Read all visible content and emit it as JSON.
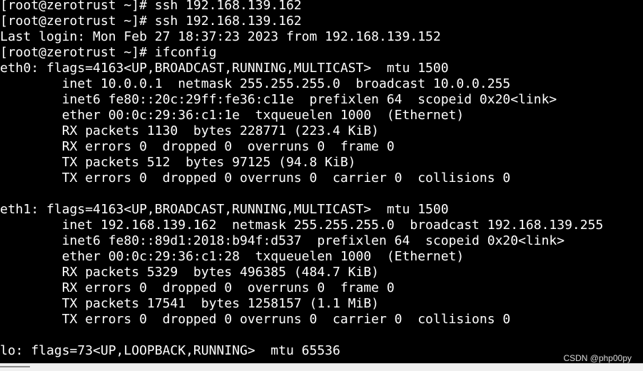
{
  "terminal": {
    "lines": [
      "[root@zerotrust ~]# ssh 192.168.139.162",
      "[root@zerotrust ~]# ssh 192.168.139.162",
      "Last login: Mon Feb 27 18:37:23 2023 from 192.168.139.152",
      "[root@zerotrust ~]# ifconfig",
      "eth0: flags=4163<UP,BROADCAST,RUNNING,MULTICAST>  mtu 1500",
      "        inet 10.0.0.1  netmask 255.255.255.0  broadcast 10.0.0.255",
      "        inet6 fe80::20c:29ff:fe36:c11e  prefixlen 64  scopeid 0x20<link>",
      "        ether 00:0c:29:36:c1:1e  txqueuelen 1000  (Ethernet)",
      "        RX packets 1130  bytes 228771 (223.4 KiB)",
      "        RX errors 0  dropped 0  overruns 0  frame 0",
      "        TX packets 512  bytes 97125 (94.8 KiB)",
      "        TX errors 0  dropped 0 overruns 0  carrier 0  collisions 0",
      "",
      "eth1: flags=4163<UP,BROADCAST,RUNNING,MULTICAST>  mtu 1500",
      "        inet 192.168.139.162  netmask 255.255.255.0  broadcast 192.168.139.255",
      "        inet6 fe80::89d1:2018:b94f:d537  prefixlen 64  scopeid 0x20<link>",
      "        ether 00:0c:29:36:c1:28  txqueuelen 1000  (Ethernet)",
      "        RX packets 5329  bytes 496385 (484.7 KiB)",
      "        RX errors 0  dropped 0  overruns 0  frame 0",
      "        TX packets 17541  bytes 1258157 (1.1 MiB)",
      "        TX errors 0  dropped 0 overruns 0  carrier 0  collisions 0",
      "",
      "lo: flags=73<UP,LOOPBACK,RUNNING>  mtu 65536"
    ]
  },
  "watermark": "CSDN @php00py",
  "colors": {
    "background": "#000000",
    "text": "#ffffff"
  }
}
